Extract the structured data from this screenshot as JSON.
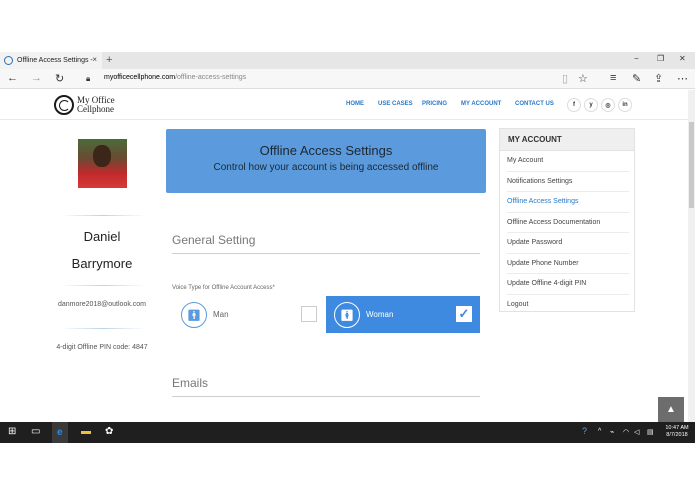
{
  "browser": {
    "tab_title": "Offline Access Settings -",
    "tab_close": "×",
    "new_tab": "+",
    "url_host": "myofficecellphone.com",
    "url_path": "/offline-access-settings",
    "win_min": "−",
    "win_max": "❐",
    "win_close": "✕"
  },
  "site": {
    "logo_line1": "My Office",
    "logo_line2": "Cellphone",
    "menu": [
      "HOME",
      "USE CASES",
      "PRICING",
      "MY ACCOUNT",
      "CONTACT US"
    ],
    "social": [
      "f",
      "y",
      "◎",
      "in"
    ]
  },
  "profile": {
    "first_name": "Daniel",
    "last_name": "Barrymore",
    "email": "danmore2018@outlook.com",
    "pin_text": "4-digit Offline PIN code: 4847"
  },
  "banner": {
    "title": "Offline Access Settings",
    "subtitle": "Control how your account is being accessed offline"
  },
  "general": {
    "heading": "General Setting",
    "voice_label": "Voice Type for Offline Account Access*",
    "option_man": "Man",
    "option_woman": "Woman",
    "selected": "Woman"
  },
  "emails": {
    "heading": "Emails"
  },
  "account_menu": {
    "heading": "MY ACCOUNT",
    "items": [
      "My Account",
      "Notifications Settings",
      "Offline Access Settings",
      "Offline Access Documentation",
      "Update Password",
      "Update Phone Number",
      "Update Offline 4-digit PIN",
      "Logout"
    ],
    "active_index": 2
  },
  "taskbar": {
    "time": "10:47 AM",
    "date": "8/7/2018"
  }
}
